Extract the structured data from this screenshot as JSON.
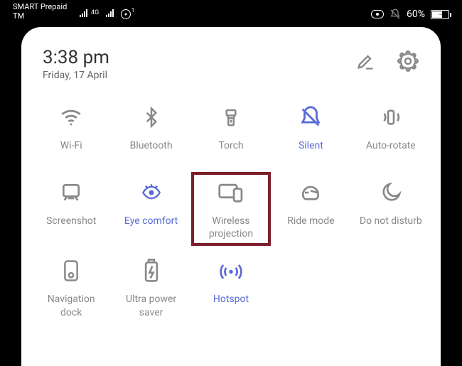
{
  "status": {
    "carrier1": "SMART Prepaid",
    "carrier2": "TM",
    "network_badge": "4G",
    "alert_count": "1",
    "battery_pct": "60%"
  },
  "header": {
    "time": "3:38 pm",
    "date": "Friday, 17 April"
  },
  "tiles": [
    {
      "id": "wifi",
      "label": "Wi-Fi",
      "active": false
    },
    {
      "id": "bluetooth",
      "label": "Bluetooth",
      "active": false
    },
    {
      "id": "torch",
      "label": "Torch",
      "active": false
    },
    {
      "id": "silent",
      "label": "Silent",
      "active": true
    },
    {
      "id": "auto-rotate",
      "label": "Auto-rotate",
      "active": false
    },
    {
      "id": "screenshot",
      "label": "Screenshot",
      "active": false
    },
    {
      "id": "eye-comfort",
      "label": "Eye comfort",
      "active": true
    },
    {
      "id": "wireless-projection",
      "label": "Wireless projection",
      "active": false,
      "highlighted": true
    },
    {
      "id": "ride-mode",
      "label": "Ride mode",
      "active": false
    },
    {
      "id": "dnd",
      "label": "Do not disturb",
      "active": false
    },
    {
      "id": "nav-dock",
      "label": "Navigation dock",
      "active": false
    },
    {
      "id": "ultra-power",
      "label": "Ultra power saver",
      "active": false
    },
    {
      "id": "hotspot",
      "label": "Hotspot",
      "active": true
    }
  ],
  "colors": {
    "accent": "#5b6bd6",
    "highlight_box": "#7a1f2b",
    "icon_gray": "#888888"
  }
}
